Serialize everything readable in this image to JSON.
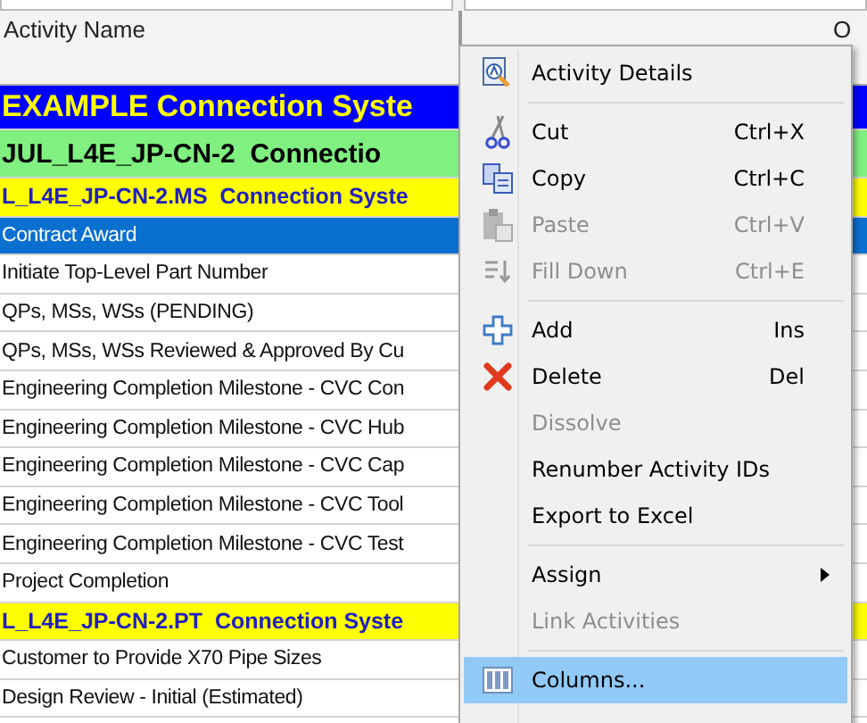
{
  "table": {
    "columns": [
      {
        "label": "Activity Name"
      },
      {
        "label": "O"
      }
    ],
    "rows": [
      {
        "kind": "project",
        "name": "EXAMPLE Connection Syste",
        "selected": false
      },
      {
        "kind": "wbs",
        "name": "JUL_L4E_JP-CN-2  Connectio",
        "selected": false
      },
      {
        "kind": "wbs_sub",
        "name": "L_L4E_JP-CN-2.MS  Connection Syste",
        "selected": false
      },
      {
        "kind": "activity",
        "name": "Contract Award",
        "selected": true
      },
      {
        "kind": "activity",
        "name": "Initiate Top-Level Part Number",
        "selected": false
      },
      {
        "kind": "activity",
        "name": "QPs, MSs, WSs (PENDING)",
        "selected": false
      },
      {
        "kind": "activity",
        "name": "QPs, MSs, WSs Reviewed & Approved By Cu",
        "selected": false
      },
      {
        "kind": "activity",
        "name": "Engineering Completion Milestone - CVC Con",
        "selected": false
      },
      {
        "kind": "activity",
        "name": "Engineering Completion Milestone - CVC Hub",
        "selected": false
      },
      {
        "kind": "activity",
        "name": "Engineering Completion Milestone - CVC Cap",
        "selected": false
      },
      {
        "kind": "activity",
        "name": "Engineering Completion Milestone - CVC Tool",
        "selected": false
      },
      {
        "kind": "activity",
        "name": "Engineering Completion Milestone - CVC Test",
        "selected": false
      },
      {
        "kind": "activity",
        "name": "Project Completion",
        "selected": false
      },
      {
        "kind": "wbs_sub",
        "name": "L_L4E_JP-CN-2.PT  Connection Syste",
        "selected": false
      },
      {
        "kind": "activity",
        "name": "Customer to Provide X70 Pipe Sizes",
        "selected": false
      },
      {
        "kind": "activity",
        "name": "Design Review - Initial (Estimated)",
        "selected": false
      }
    ]
  },
  "context_menu": {
    "items": [
      {
        "kind": "item",
        "label": "Activity Details",
        "disabled": false,
        "selected": false
      },
      {
        "kind": "separator"
      },
      {
        "kind": "item",
        "label": "Cut",
        "shortcut": "Ctrl+X",
        "disabled": false,
        "selected": false
      },
      {
        "kind": "item",
        "label": "Copy",
        "shortcut": "Ctrl+C",
        "disabled": false,
        "selected": false
      },
      {
        "kind": "item",
        "label": "Paste",
        "shortcut": "Ctrl+V",
        "disabled": true,
        "selected": false
      },
      {
        "kind": "item",
        "label": "Fill Down",
        "shortcut": "Ctrl+E",
        "disabled": true,
        "selected": false
      },
      {
        "kind": "separator"
      },
      {
        "kind": "item",
        "label": "Add",
        "shortcut": "Ins",
        "disabled": false,
        "selected": false
      },
      {
        "kind": "item",
        "label": "Delete",
        "shortcut": "Del",
        "disabled": false,
        "selected": false
      },
      {
        "kind": "item",
        "label": "Dissolve",
        "disabled": true,
        "selected": false
      },
      {
        "kind": "item",
        "label": "Renumber Activity IDs",
        "disabled": false,
        "selected": false
      },
      {
        "kind": "item",
        "label": "Export to Excel",
        "disabled": false,
        "selected": false
      },
      {
        "kind": "separator"
      },
      {
        "kind": "item",
        "label": "Assign",
        "submenu": true,
        "disabled": false,
        "selected": false
      },
      {
        "kind": "item",
        "label": "Link Activities",
        "disabled": true,
        "selected": false
      },
      {
        "kind": "separator"
      },
      {
        "kind": "item",
        "label": "Columns...",
        "disabled": false,
        "selected": true
      }
    ]
  }
}
